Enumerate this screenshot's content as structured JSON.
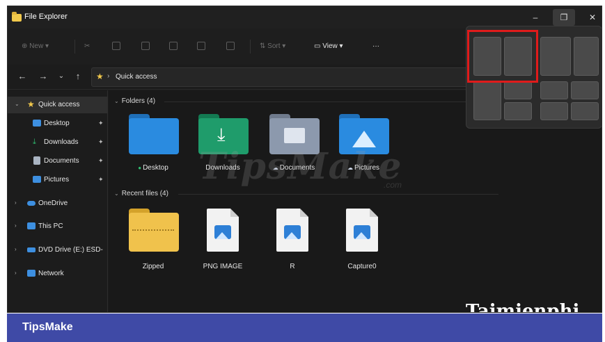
{
  "window": {
    "title": "File Explorer"
  },
  "title_controls": {
    "minimize": "–",
    "maximize": "❐",
    "close": "✕"
  },
  "toolbar": {
    "new_label": "New",
    "sort_label": "Sort",
    "view_label": "View",
    "more_label": "···"
  },
  "address": {
    "path": "Quick access"
  },
  "sidebar": {
    "items": [
      {
        "label": "Quick access",
        "icon": "star-icon",
        "color": "#f2c94c"
      },
      {
        "label": "Desktop",
        "icon": "desktop-icon",
        "color": "#3d8fe0",
        "pinned": true
      },
      {
        "label": "Downloads",
        "icon": "download-icon",
        "color": "#2fbf71",
        "pinned": true
      },
      {
        "label": "Documents",
        "icon": "document-icon",
        "color": "#a9b4c2",
        "pinned": true
      },
      {
        "label": "Pictures",
        "icon": "pictures-icon",
        "color": "#3d8fe0",
        "pinned": true
      },
      {
        "label": "OneDrive",
        "icon": "cloud-icon",
        "color": "#3d8fe0"
      },
      {
        "label": "This PC",
        "icon": "computer-icon",
        "color": "#3d8fe0"
      },
      {
        "label": "DVD Drive (E:) ESD-",
        "icon": "dvd-icon",
        "color": "#3d8fe0"
      },
      {
        "label": "Network",
        "icon": "network-icon",
        "color": "#3d8fe0"
      }
    ]
  },
  "content": {
    "folders_title": "Folders (4)",
    "recent_title": "Recent files (4)",
    "folders": [
      {
        "label": "Desktop",
        "color": "#2a8be0",
        "tab_color": "#1f6fb8"
      },
      {
        "label": "Downloads",
        "color": "#1f9c6b",
        "tab_color": "#137a52"
      },
      {
        "label": "Documents",
        "color": "#8c99ad",
        "tab_color": "#6f7a8c"
      },
      {
        "label": "Pictures",
        "color": "#2a8be0",
        "tab_color": "#1f6fb8"
      }
    ],
    "recent": [
      {
        "label": "Zipped"
      },
      {
        "label": "PNG IMAGE"
      },
      {
        "label": "R"
      },
      {
        "label": "Capture0"
      }
    ]
  },
  "watermarks": {
    "center": "TipsMake",
    "center_suffix": ".com",
    "corner": "Taimienphi"
  },
  "banner": {
    "text": "TipsMake"
  },
  "colors": {
    "accent": "#3f4aa6",
    "highlight": "#e01b1b"
  }
}
